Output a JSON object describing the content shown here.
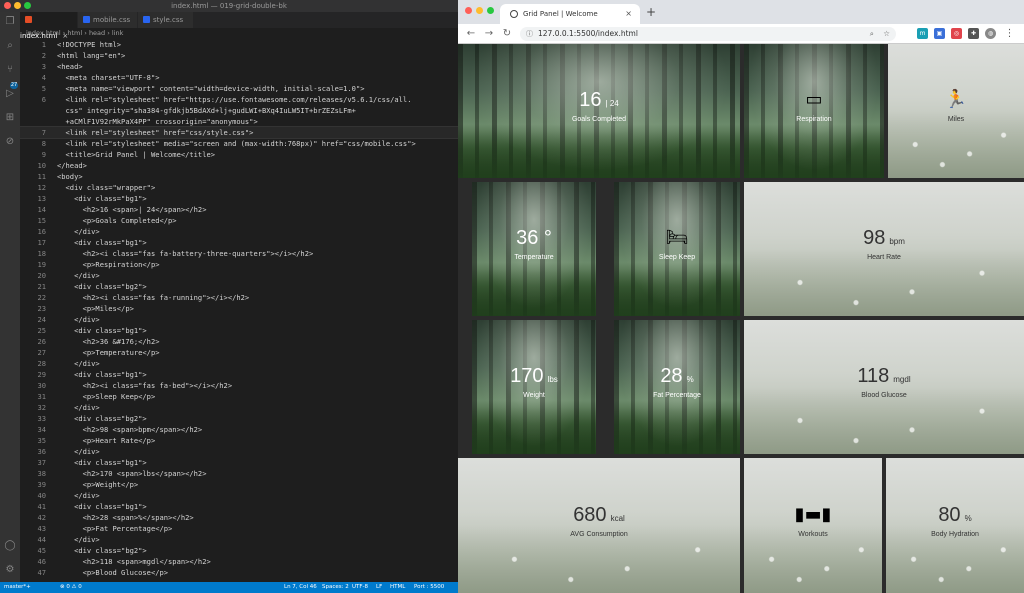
{
  "vscode": {
    "window_title": "index.html — 019-grid-double-bk",
    "tabs": [
      "index.html",
      "mobile.css",
      "style.css"
    ],
    "breadcrumb": [
      "index.html",
      "html",
      "head",
      "link"
    ],
    "activity_badge": "27",
    "code_lines": [
      {
        "n": "1",
        "text": "<!DOCTYPE html>"
      },
      {
        "n": "2",
        "text": "<html lang=\"en\">"
      },
      {
        "n": "3",
        "text": "<head>"
      },
      {
        "n": "4",
        "text": "  <meta charset=\"UTF-8\">"
      },
      {
        "n": "5",
        "text": "  <meta name=\"viewport\" content=\"width=device-width, initial-scale=1.0\">"
      },
      {
        "n": "6",
        "text": "  <link rel=\"stylesheet\" href=\"https://use.fontawesome.com/releases/v5.6.1/css/all."
      },
      {
        "n": "",
        "text": "  css\" integrity=\"sha384-gfdkjb5BdAXd+lj+gudLWI+BXq4IuLW5IT+brZEZsLFm+"
      },
      {
        "n": "",
        "text": "  +aCMlF1V92rMkPaX4PP\" crossorigin=\"anonymous\">"
      },
      {
        "n": "7",
        "text": "  <link rel=\"stylesheet\" href=\"css/style.css\">"
      },
      {
        "n": "8",
        "text": "  <link rel=\"stylesheet\" media=\"screen and (max-width:768px)\" href=\"css/mobile.css\">"
      },
      {
        "n": "9",
        "text": "  <title>Grid Panel | Welcome</title>"
      },
      {
        "n": "10",
        "text": "</head>"
      },
      {
        "n": "11",
        "text": "<body>"
      },
      {
        "n": "12",
        "text": "  <div class=\"wrapper\">"
      },
      {
        "n": "13",
        "text": "    <div class=\"bg1\">"
      },
      {
        "n": "14",
        "text": "      <h2>16 <span>| 24</span></h2>"
      },
      {
        "n": "15",
        "text": "      <p>Goals Completed</p>"
      },
      {
        "n": "16",
        "text": "    </div>"
      },
      {
        "n": "17",
        "text": "    <div class=\"bg1\">"
      },
      {
        "n": "18",
        "text": "      <h2><i class=\"fas fa-battery-three-quarters\"></i></h2>"
      },
      {
        "n": "19",
        "text": "      <p>Respiration</p>"
      },
      {
        "n": "20",
        "text": "    </div>"
      },
      {
        "n": "21",
        "text": "    <div class=\"bg2\">"
      },
      {
        "n": "22",
        "text": "      <h2><i class=\"fas fa-running\"></i></h2>"
      },
      {
        "n": "23",
        "text": "      <p>Miles</p>"
      },
      {
        "n": "24",
        "text": "    </div>"
      },
      {
        "n": "25",
        "text": "    <div class=\"bg1\">"
      },
      {
        "n": "26",
        "text": "      <h2>36 &#176;</h2>"
      },
      {
        "n": "27",
        "text": "      <p>Temperature</p>"
      },
      {
        "n": "28",
        "text": "    </div>"
      },
      {
        "n": "29",
        "text": "    <div class=\"bg1\">"
      },
      {
        "n": "30",
        "text": "      <h2><i class=\"fas fa-bed\"></i></h2>"
      },
      {
        "n": "31",
        "text": "      <p>Sleep Keep</p>"
      },
      {
        "n": "32",
        "text": "    </div>"
      },
      {
        "n": "33",
        "text": "    <div class=\"bg2\">"
      },
      {
        "n": "34",
        "text": "      <h2>98 <span>bpm</span></h2>"
      },
      {
        "n": "35",
        "text": "      <p>Heart Rate</p>"
      },
      {
        "n": "36",
        "text": "    </div>"
      },
      {
        "n": "37",
        "text": "    <div class=\"bg1\">"
      },
      {
        "n": "38",
        "text": "      <h2>170 <span>lbs</span></h2>"
      },
      {
        "n": "39",
        "text": "      <p>Weight</p>"
      },
      {
        "n": "40",
        "text": "    </div>"
      },
      {
        "n": "41",
        "text": "    <div class=\"bg1\">"
      },
      {
        "n": "42",
        "text": "      <h2>28 <span>%</span></h2>"
      },
      {
        "n": "43",
        "text": "      <p>Fat Percentage</p>"
      },
      {
        "n": "44",
        "text": "    </div>"
      },
      {
        "n": "45",
        "text": "    <div class=\"bg2\">"
      },
      {
        "n": "46",
        "text": "      <h2>118 <span>mgdl</span></h2>"
      },
      {
        "n": "47",
        "text": "      <p>Blood Glucose</p>"
      }
    ],
    "current_line_index": 8,
    "status": {
      "branch": "master*+",
      "problems": "⊗ 0 ⚠ 0",
      "position": "Ln 7, Col 46",
      "spaces": "Spaces: 2",
      "encoding": "UTF-8",
      "eol": "LF",
      "language": "HTML",
      "port": "Port : 5500"
    }
  },
  "browser": {
    "tab_title": "Grid Panel | Welcome",
    "url": "127.0.0.1:5500/index.html",
    "tiles": [
      {
        "value": "16",
        "unit": "| 24",
        "icon": "",
        "label": "Goals Completed",
        "bg": "forest"
      },
      {
        "value": "",
        "unit": "",
        "icon": "battery-three-quarters",
        "label": "Respiration",
        "bg": "forest"
      },
      {
        "value": "",
        "unit": "",
        "icon": "running",
        "label": "Miles",
        "bg": "meadow"
      },
      {
        "value": "36 °",
        "unit": "",
        "icon": "",
        "label": "Temperature",
        "bg": "forest"
      },
      {
        "value": "",
        "unit": "",
        "icon": "bed",
        "label": "Sleep Keep",
        "bg": "forest"
      },
      {
        "value": "98",
        "unit": "bpm",
        "icon": "",
        "label": "Heart Rate",
        "bg": "meadow"
      },
      {
        "value": "170",
        "unit": "lbs",
        "icon": "",
        "label": "Weight",
        "bg": "forest"
      },
      {
        "value": "28",
        "unit": "%",
        "icon": "",
        "label": "Fat Percentage",
        "bg": "forest"
      },
      {
        "value": "118",
        "unit": "mgdl",
        "icon": "",
        "label": "Blood Glucose",
        "bg": "meadow"
      },
      {
        "value": "680",
        "unit": "kcal",
        "icon": "",
        "label": "AVG Consumption",
        "bg": "meadow"
      },
      {
        "value": "",
        "unit": "",
        "icon": "dumbbell",
        "label": "Workouts",
        "bg": "meadow"
      },
      {
        "value": "80",
        "unit": "%",
        "icon": "",
        "label": "Body Hydration",
        "bg": "meadow"
      }
    ]
  }
}
